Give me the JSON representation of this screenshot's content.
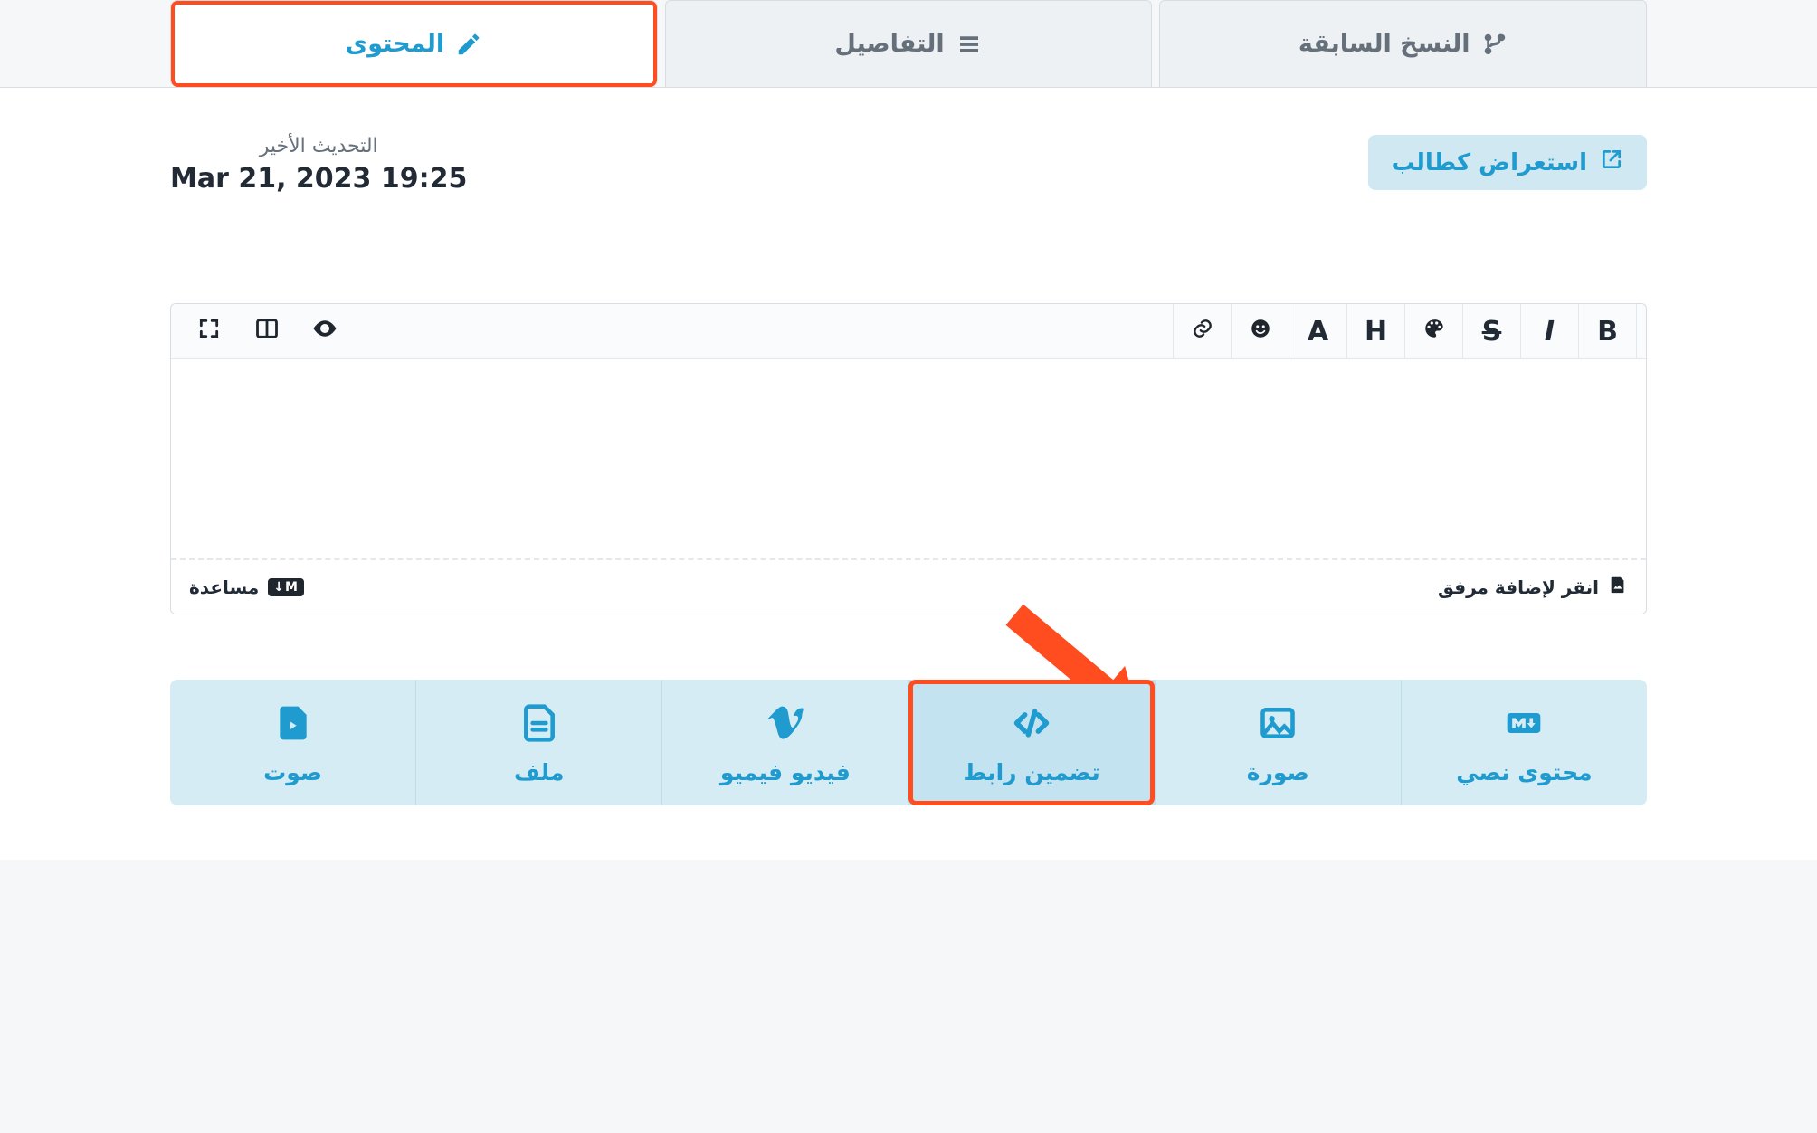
{
  "tabs": {
    "content": "المحتوى",
    "details": "التفاصيل",
    "versions": "النسخ السابقة"
  },
  "head": {
    "preview_btn": "استعراض كطالب",
    "last_update_label": "التحديث الأخير",
    "last_update_value": "Mar 21, 2023 19:25"
  },
  "editor": {
    "body": "",
    "attach_label": "انقر لإضافة مرفق",
    "help_label": "مساعدة",
    "md_badge": "M↓",
    "toolbar": {
      "bold": "B",
      "italic": "I",
      "strike": "S",
      "header": "H",
      "font": "A"
    }
  },
  "tiles": {
    "text": "محتوى نصي",
    "image": "صورة",
    "embed": "تضمين رابط",
    "vimeo": "فيديو فيميو",
    "file": "ملف",
    "audio": "صوت"
  },
  "colors": {
    "accent": "#1f9bcf",
    "highlight": "#ff4d1f"
  }
}
